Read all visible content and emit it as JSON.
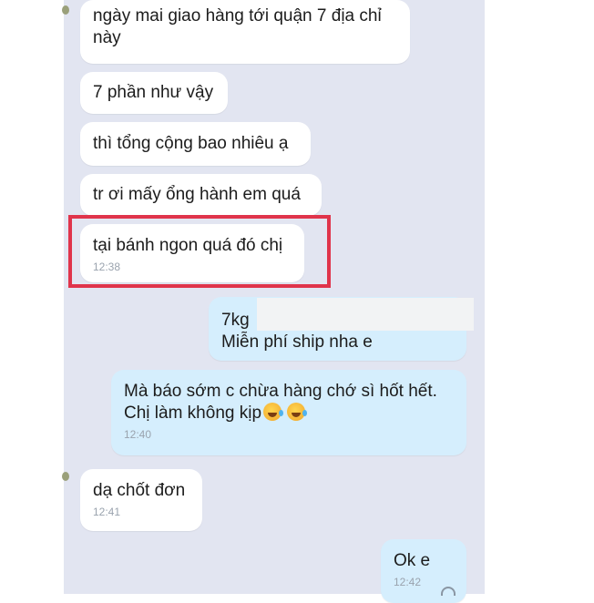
{
  "messages": [
    {
      "lines": [
        "ngày mai giao hàng tới quận 7 địa chỉ",
        "này"
      ],
      "time": ""
    },
    {
      "lines": [
        "7 phần như vậy"
      ],
      "time": ""
    },
    {
      "lines": [
        "thì tổng cộng bao nhiêu ạ"
      ],
      "time": ""
    },
    {
      "lines": [
        "tr ơi mấy ổng hành em quá"
      ],
      "time": ""
    },
    {
      "lines": [
        "tại bánh ngon quá đó chị"
      ],
      "time": "12:38"
    },
    {
      "lines": [
        "7kg",
        "Miễn phí ship nha e"
      ],
      "time": ""
    },
    {
      "lines": [
        "Mà báo sớm c chừa hàng chớ sì hốt hết.",
        "Chị làm không kịp"
      ],
      "time": "12:40"
    },
    {
      "lines": [
        "dạ chốt đơn"
      ],
      "time": "12:41"
    },
    {
      "lines": [
        "Ok e"
      ],
      "time": "12:42"
    }
  ],
  "emoji": [
    "rofl-emoji",
    "rofl-emoji"
  ],
  "colors": {
    "chat_background": "#e2e5f1",
    "received_bubble": "#ffffff",
    "sent_bubble": "#d5eefd",
    "highlight": "#e0344b"
  }
}
